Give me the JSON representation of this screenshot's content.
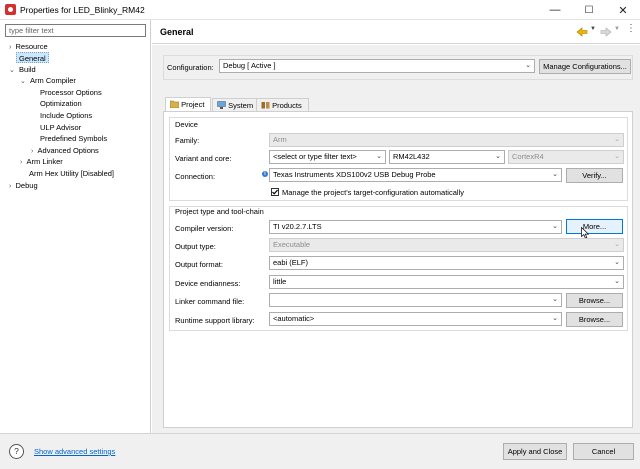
{
  "window": {
    "title": "Properties for LED_Blinky_RM42",
    "controls": [
      "—",
      "☐",
      "✕"
    ]
  },
  "sidebar": {
    "filter_placeholder": "type filter text",
    "items": [
      {
        "label": "Resource",
        "twist": "›"
      },
      {
        "label": "General"
      },
      {
        "label": "Build",
        "twist": "⌄"
      },
      {
        "label": "Arm Compiler",
        "twist": "⌄"
      },
      {
        "label": "Processor Options"
      },
      {
        "label": "Optimization"
      },
      {
        "label": "Include Options"
      },
      {
        "label": "ULP Advisor"
      },
      {
        "label": "Predefined Symbols"
      },
      {
        "label": "Advanced Options",
        "twist": "›"
      },
      {
        "label": "Arm Linker",
        "twist": "›"
      },
      {
        "label": "Arm Hex Utility  [Disabled]"
      },
      {
        "label": "Debug",
        "twist": "›"
      }
    ]
  },
  "header": {
    "title": "General"
  },
  "configuration": {
    "label": "Configuration:",
    "value": "Debug  [ Active ]",
    "manage_label": "Manage Configurations..."
  },
  "tabs": [
    {
      "label": "Project"
    },
    {
      "label": "System"
    },
    {
      "label": "Products"
    }
  ],
  "device": {
    "group_label": "Device",
    "family_label": "Family:",
    "family_value": "Arm",
    "variant_label": "Variant and core:",
    "variant_filter": "<select or type filter text>",
    "variant_value": "RM42L432",
    "core_value": "CortexR4",
    "connection_label": "Connection:",
    "connection_value": "Texas Instruments XDS100v2 USB Debug Probe",
    "verify_label": "Verify...",
    "manage_checkbox": "Manage the project's target-configuration automatically"
  },
  "toolchain": {
    "group_label": "Project type and tool-chain",
    "compiler_label": "Compiler version:",
    "compiler_value": "TI v20.2.7.LTS",
    "more_label": "More...",
    "output_type_label": "Output type:",
    "output_type_value": "Executable",
    "output_format_label": "Output format:",
    "output_format_value": "eabi (ELF)",
    "endianness_label": "Device endianness:",
    "endianness_value": "little",
    "linker_cmd_label": "Linker command file:",
    "linker_cmd_value": "",
    "browse_label": "Browse...",
    "runtime_label": "Runtime support library:",
    "runtime_value": "<automatic>"
  },
  "footer": {
    "help_icon": "?",
    "advanced_link": "Show advanced settings",
    "apply_close": "Apply and Close",
    "cancel": "Cancel"
  },
  "colors": {
    "accent": "#0066cc",
    "selection": "#cce8ff",
    "title_icon": "#d32f2f"
  }
}
